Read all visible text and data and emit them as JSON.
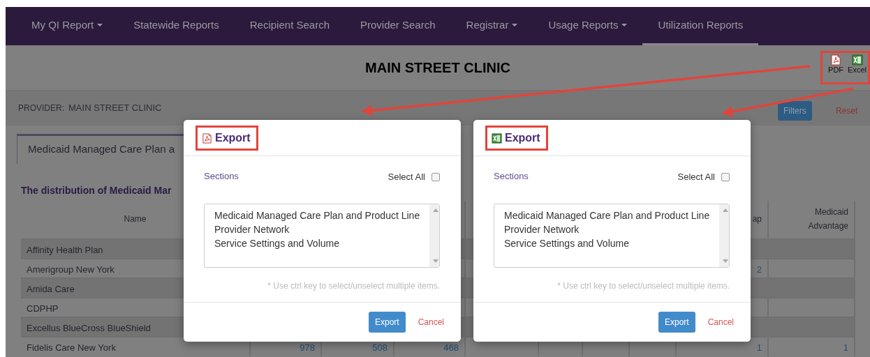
{
  "nav": {
    "items": [
      {
        "label": "My QI Report",
        "dropdown": true,
        "selected": false
      },
      {
        "label": "Statewide Reports",
        "dropdown": false,
        "selected": false
      },
      {
        "label": "Recipient Search",
        "dropdown": false,
        "selected": false
      },
      {
        "label": "Provider Search",
        "dropdown": false,
        "selected": false
      },
      {
        "label": "Registrar",
        "dropdown": true,
        "selected": false
      },
      {
        "label": "Usage Reports",
        "dropdown": true,
        "selected": false
      },
      {
        "label": "Utilization Reports",
        "dropdown": false,
        "selected": true
      }
    ]
  },
  "header": {
    "title": "MAIN STREET CLINIC",
    "exports": [
      {
        "kind": "pdf",
        "label": "PDF"
      },
      {
        "kind": "excel",
        "label": "Excel"
      }
    ]
  },
  "provider": {
    "label": "PROVIDER:",
    "value": "MAIN STREET CLINIC"
  },
  "filters_button": "Filters",
  "reset_link": "Reset",
  "tabs": [
    {
      "label": "Medicaid Managed Care Plan a",
      "selected": true
    }
  ],
  "table": {
    "heading": "The distribution of Medicaid Mar",
    "columns": [
      "Name",
      null,
      null,
      null,
      null,
      null,
      null,
      null,
      "ap",
      "Medicaid Advantage"
    ],
    "rows": [
      [
        "Affinity Health Plan",
        null,
        null,
        null,
        null,
        null,
        null,
        null,
        null,
        null
      ],
      [
        "Amerigroup New York",
        null,
        null,
        null,
        null,
        null,
        null,
        null,
        "2",
        null
      ],
      [
        "Amida Care",
        null,
        null,
        null,
        null,
        null,
        null,
        null,
        null,
        null
      ],
      [
        "CDPHP",
        null,
        null,
        null,
        null,
        null,
        null,
        null,
        null,
        null
      ],
      [
        "Excellus BlueCross BlueShield",
        null,
        null,
        null,
        null,
        null,
        null,
        null,
        null,
        null
      ],
      [
        "Fidelis Care New York",
        "978",
        "508",
        "468",
        null,
        null,
        null,
        null,
        "1",
        "1"
      ]
    ]
  },
  "dialogs": [
    {
      "kind": "pdf",
      "title": "Export",
      "sections_label": "Sections",
      "select_all": {
        "label": "Select All",
        "checked": false
      },
      "options": [
        "Medicaid Managed Care Plan and Product Line",
        "Provider Network",
        "Service Settings and Volume"
      ],
      "hint": "* Use ctrl key to select/unselect multiple items.",
      "export_button": "Export",
      "cancel_link": "Cancel"
    },
    {
      "kind": "excel",
      "title": "Export",
      "sections_label": "Sections",
      "select_all": {
        "label": "Select All",
        "checked": false
      },
      "options": [
        "Medicaid Managed Care Plan and Product Line",
        "Provider Network",
        "Service Settings and Volume"
      ],
      "hint": "* Use ctrl key to select/unselect multiple items.",
      "export_button": "Export",
      "cancel_link": "Cancel"
    }
  ]
}
